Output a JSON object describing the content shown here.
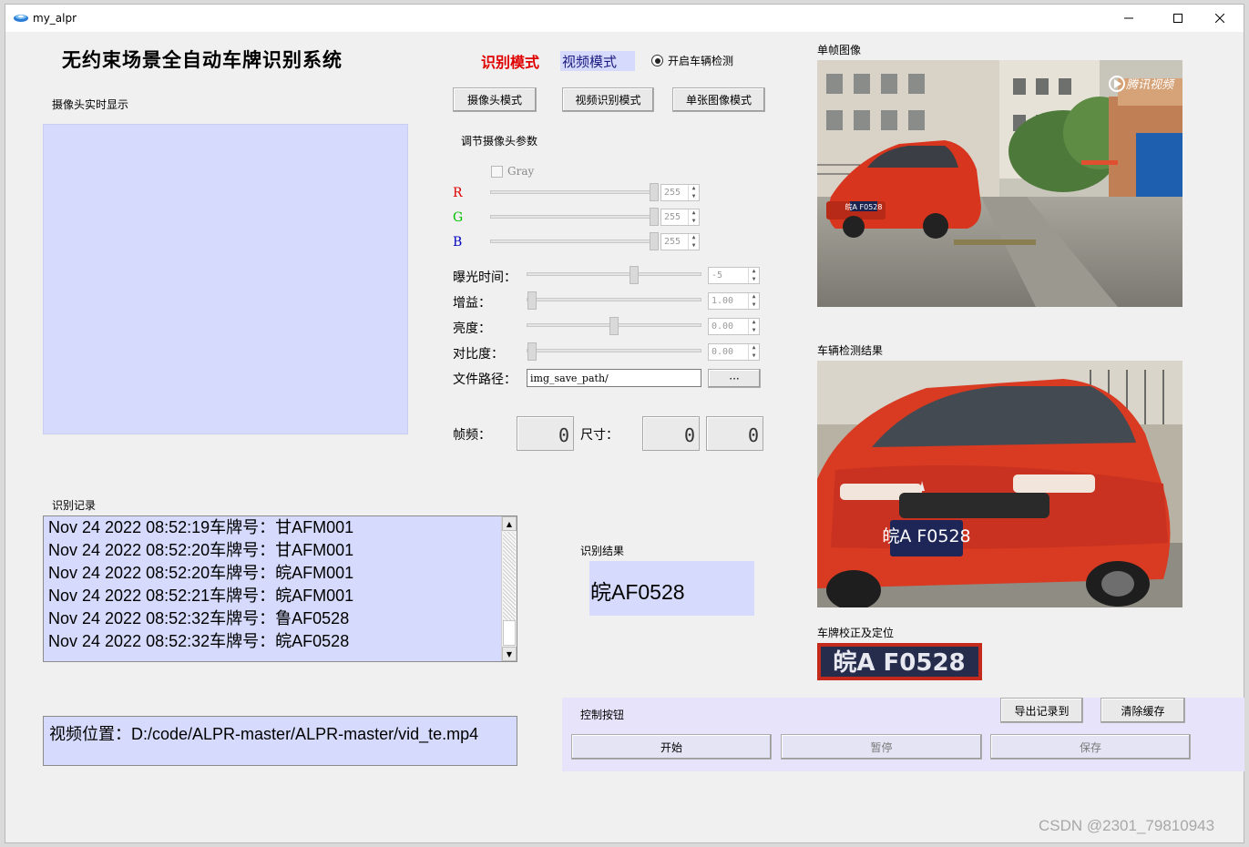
{
  "window": {
    "title": "my_alpr",
    "minimize_icon": "minimize-icon",
    "maximize_icon": "maximize-icon",
    "close_icon": "close-icon"
  },
  "header": {
    "title": "无约束场景全自动车牌识别系统",
    "mode_label": "识别模式",
    "mode_value": "视频模式",
    "vehicle_detect_label": "开启车辆检测",
    "vehicle_detect_checked": true
  },
  "camera": {
    "section_label": "摄像头实时显示"
  },
  "mode_buttons": {
    "camera": "摄像头模式",
    "video": "视频识别模式",
    "image": "单张图像模式"
  },
  "camera_params": {
    "section_label": "调节摄像头参数",
    "gray_label": "Gray",
    "gray_checked": false,
    "channels": [
      {
        "label": "R",
        "value": "255",
        "level": 1.0,
        "color": "#e00000"
      },
      {
        "label": "G",
        "value": "255",
        "level": 1.0,
        "color": "#00c000"
      },
      {
        "label": "B",
        "value": "255",
        "level": 1.0,
        "color": "#0000c0"
      }
    ],
    "settings": [
      {
        "label": "曝光时间：",
        "value": "-5",
        "level": 0.6
      },
      {
        "label": "增益：",
        "value": "1.00",
        "level": 0.0
      },
      {
        "label": "亮度：",
        "value": "0.00",
        "level": 0.5
      },
      {
        "label": "对比度：",
        "value": "0.00",
        "level": 0.0
      }
    ],
    "file_path_label": "文件路径：",
    "file_path_value": "img_save_path/",
    "browse_label": "···"
  },
  "stats": {
    "frames_label": "帧频：",
    "frames_value": "0",
    "size_label": "尺寸：",
    "width_value": "0",
    "height_value": "0"
  },
  "log": {
    "section_label": "识别记录",
    "entries": [
      {
        "time": "Nov 24 2022 08:52:19",
        "prefix": "车牌号：",
        "plate": "甘AFM001"
      },
      {
        "time": "Nov 24 2022 08:52:20",
        "prefix": "车牌号：",
        "plate": "甘AFM001"
      },
      {
        "time": "Nov 24 2022 08:52:20",
        "prefix": "车牌号：",
        "plate": "皖AFM001"
      },
      {
        "time": "Nov 24 2022 08:52:21",
        "prefix": "车牌号：",
        "plate": "皖AFM001"
      },
      {
        "time": "Nov 24 2022 08:52:32",
        "prefix": "车牌号：",
        "plate": "鲁AF0528"
      },
      {
        "time": "Nov 24 2022 08:52:32",
        "prefix": "车牌号：",
        "plate": "皖AF0528"
      }
    ]
  },
  "video": {
    "label": "视频位置：",
    "path": "D:/code/ALPR-master/ALPR-master/vid_te.mp4"
  },
  "result": {
    "section_label": "识别结果",
    "plate": "皖AF0528"
  },
  "images": {
    "frame_label": "单帧图像",
    "detection_label": "车辆检测结果",
    "plate_label": "车牌校正及定位",
    "frame_watermark": "腾讯视频",
    "frame_plate_text": "皖A F0528",
    "detection_plate_text": "皖A F0528",
    "plate_crop_text": "皖A F0528"
  },
  "controls": {
    "section_label": "控制按钮",
    "export": "导出记录到",
    "clear": "清除缓存",
    "start": "开始",
    "pause": "暂停",
    "save": "保存"
  },
  "footer": {
    "watermark": "CSDN @2301_79810943"
  }
}
